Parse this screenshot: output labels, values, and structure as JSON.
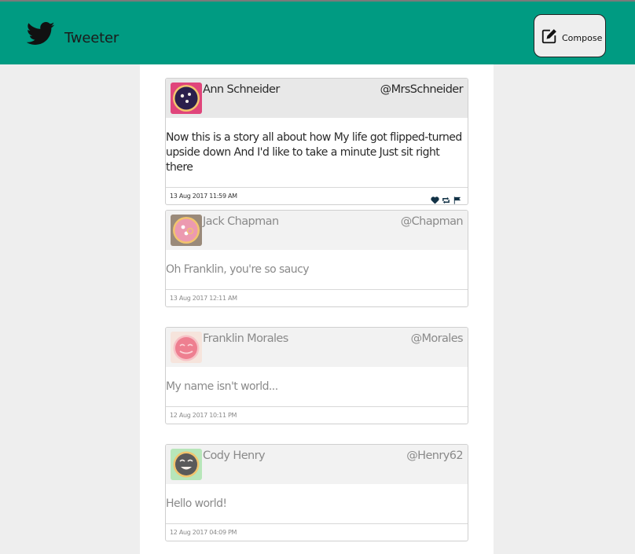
{
  "app": {
    "brand": "Tweeter",
    "compose_label": "Compose"
  },
  "colors": {
    "navbar": "#009b82",
    "page_background": "#eeeeee",
    "feed_background": "#ffffff"
  },
  "icons": {
    "logo": "twitter-bird-icon",
    "compose": "edit-pencil-icon",
    "like": "heart-icon",
    "retweet": "retweet-icon",
    "flag": "flag-icon"
  },
  "tweets": [
    {
      "name": "Ann Schneider",
      "handle": "@MrsSchneider",
      "text": "Now this is a story all about how My life got flipped-turned upside down And I'd like to take a minute Just sit right there",
      "time": "13 Aug 2017 11:59 AM",
      "avatar_color": "#e0457b"
    },
    {
      "name": "Jack Chapman",
      "handle": "@Chapman",
      "text": "Oh Franklin, you're so saucy",
      "time": "13 Aug 2017 12:11 AM",
      "avatar_color": "#9a8a7a"
    },
    {
      "name": "Franklin Morales",
      "handle": "@Morales",
      "text": "My name isn't world...",
      "time": "12 Aug 2017 10:11 PM",
      "avatar_color": "#f6e4dc"
    },
    {
      "name": "Cody Henry",
      "handle": "@Henry62",
      "text": "Hello world!",
      "time": "12 Aug 2017 04:09 PM",
      "avatar_color": "#b7e6b9"
    }
  ]
}
